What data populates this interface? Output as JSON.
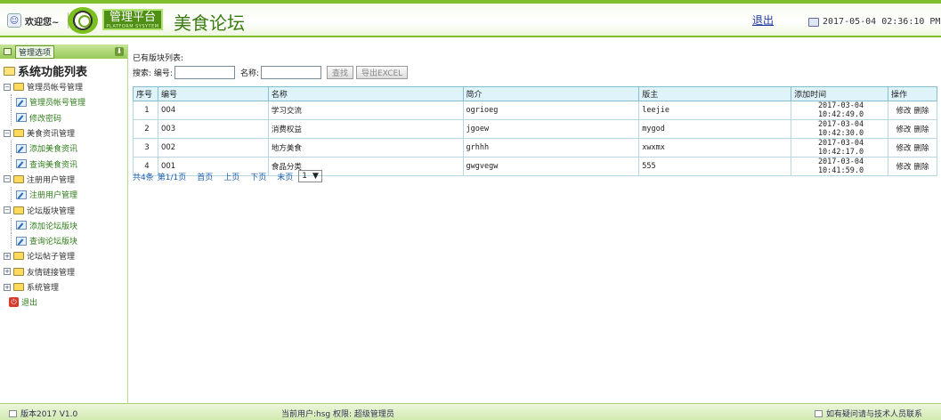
{
  "header": {
    "welcome": "欢迎您~",
    "platform_title": "管理平台",
    "platform_sub": "PLATFORM SYSYTEM",
    "site_title": "美食论坛",
    "logout": "退出",
    "datetime": "2017-05-04 02:36:10 PM"
  },
  "sidebar": {
    "panel_label": "管理选项",
    "root": "系统功能列表",
    "groups": [
      {
        "label": "管理员帐号管理",
        "items": [
          "管理员帐号管理",
          "修改密码"
        ]
      },
      {
        "label": "美食资讯管理",
        "items": [
          "添加美食资讯",
          "查询美食资讯"
        ]
      },
      {
        "label": "注册用户管理",
        "items": [
          "注册用户管理"
        ]
      },
      {
        "label": "论坛版块管理",
        "items": [
          "添加论坛版块",
          "查询论坛版块"
        ]
      },
      {
        "label": "论坛帖子管理",
        "items": []
      },
      {
        "label": "友情链接管理",
        "items": []
      },
      {
        "label": "系统管理",
        "items": []
      }
    ],
    "exit": "退出"
  },
  "main": {
    "list_title": "已有版块列表:",
    "search_label": "搜索: 编号:",
    "name_label": "名称:",
    "search_button": "查找",
    "export_button": "导出EXCEL",
    "columns": [
      "序号",
      "编号",
      "名称",
      "简介",
      "版主",
      "添加时间",
      "操作"
    ],
    "rows": [
      [
        "1",
        "004",
        "学习交流",
        "ogrioeg",
        "leejie",
        "2017-03-04 10:42:49.0"
      ],
      [
        "2",
        "003",
        "消费权益",
        "jgoew",
        "mygod",
        "2017-03-04 10:42:30.0"
      ],
      [
        "3",
        "002",
        "地方美食",
        "grhhh",
        "xwxmx",
        "2017-03-04 10:42:17.0"
      ],
      [
        "4",
        "001",
        "食品分类",
        "gwgvegw",
        "555",
        "2017-03-04 10:41:59.0"
      ]
    ],
    "edit_label": "修改",
    "delete_label": "删除",
    "pager": {
      "total": "共4条",
      "page": "第1/1页",
      "first": "首页",
      "prev": "上页",
      "next": "下页",
      "last": "末页",
      "select_value": "1"
    }
  },
  "footer": {
    "version": "版本2017 V1.0",
    "user_info": "当前用户:hsg 权限: 超级管理员",
    "contact": "如有疑问请与技术人员联系"
  }
}
